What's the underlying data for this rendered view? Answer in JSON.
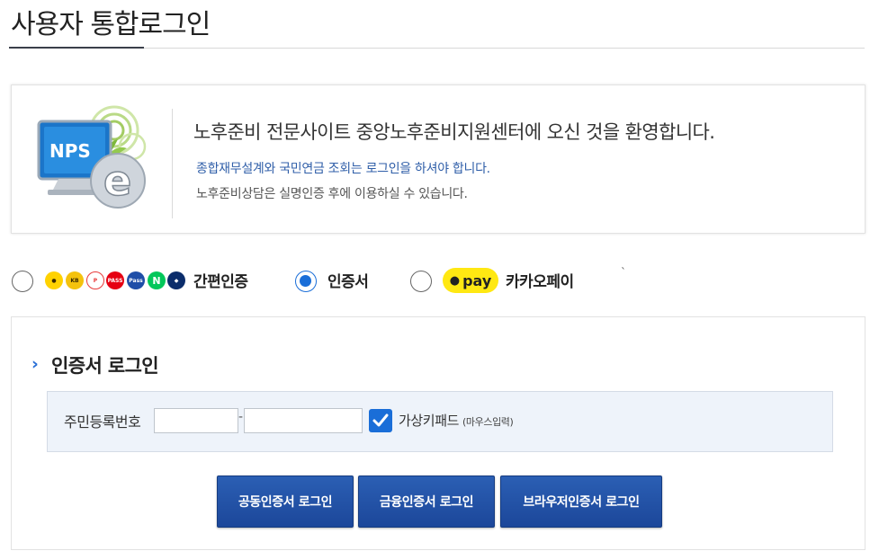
{
  "page": {
    "title": "사용자 통합로그인"
  },
  "welcome": {
    "logo_text": "NPS",
    "logo_letter": "e",
    "headline": "노후준비 전문사이트 중앙노후준비지원센터에 오신 것을 환영합니다.",
    "notice": "종합재무설계와 국민연금 조회는 로그인을 하셔야 합니다.",
    "info": "노후준비상담은 실명인증 후에 이용하실 수 있습니다."
  },
  "auth_options": [
    {
      "label": "간편인증",
      "selected": false
    },
    {
      "label": "인증서",
      "selected": true
    },
    {
      "label": "카카오페이",
      "selected": false
    }
  ],
  "provider_icons": [
    {
      "name": "kakao-icon",
      "color": "#ffd200"
    },
    {
      "name": "kb-icon",
      "color": "#f4c20d"
    },
    {
      "name": "payco-icon",
      "color": "#e83a3a"
    },
    {
      "name": "pass-icon",
      "color": "#e60012"
    },
    {
      "name": "samsung-pass-icon",
      "color": "#1f4ea8"
    },
    {
      "name": "naver-icon",
      "color": "#03c75a"
    },
    {
      "name": "shinhan-icon",
      "color": "#0b2d6b"
    }
  ],
  "pay_badge": "pay",
  "stray_mark": "ˋ",
  "login": {
    "section_title": "인증서 로그인",
    "rrn_label": "주민등록번호",
    "rrn_front_value": "",
    "rrn_back_value": "",
    "dash": "-",
    "keypad_label": "가상키패드",
    "keypad_sub": "(마우스입력)",
    "keypad_checked": true
  },
  "buttons": {
    "common_cert": "공동인증서 로그인",
    "financial_cert": "금융인증서 로그인",
    "browser_cert": "브라우저인증서 로그인"
  },
  "colors": {
    "accent": "#1a6ed8",
    "button": "#22519f",
    "notice_text": "#2f5ea8",
    "kakao_yellow": "#ffe812"
  }
}
